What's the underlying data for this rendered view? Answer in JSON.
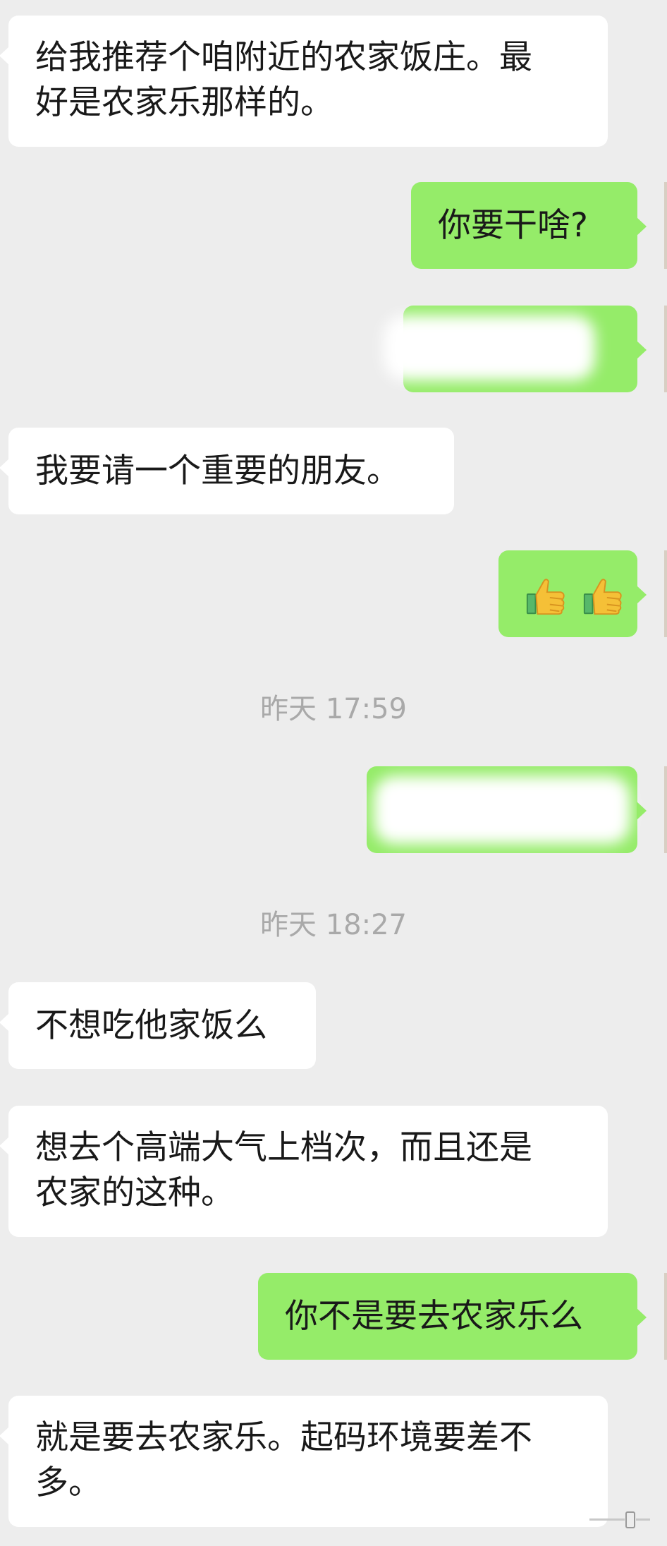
{
  "messages": [
    {
      "side": "in",
      "text": "给我推荐个咱附近的农家饭庄。最\n好是农家乐那样的。"
    },
    {
      "side": "out",
      "text": "你要干啥?"
    },
    {
      "side": "out",
      "text": ""
    },
    {
      "side": "in",
      "text": "我要请一个重要的朋友。"
    },
    {
      "side": "out",
      "emoji": "thumbs-up thumbs-up"
    },
    {
      "side": "out",
      "text": ""
    },
    {
      "side": "in",
      "text": "不想吃他家饭么"
    },
    {
      "side": "in",
      "text": "想去个高端大气上档次，而且还是\n农家的这种。"
    },
    {
      "side": "out",
      "text": "你不是要去农家乐么"
    },
    {
      "side": "in",
      "text": "就是要去农家乐。起码环境要差不\n多。"
    }
  ],
  "timestamps": [
    "昨天 17:59",
    "昨天 18:27"
  ],
  "colors": {
    "background": "#ededed",
    "incoming_bubble": "#ffffff",
    "outgoing_bubble": "#95ec69",
    "timestamp_text": "#a9a9a9"
  }
}
